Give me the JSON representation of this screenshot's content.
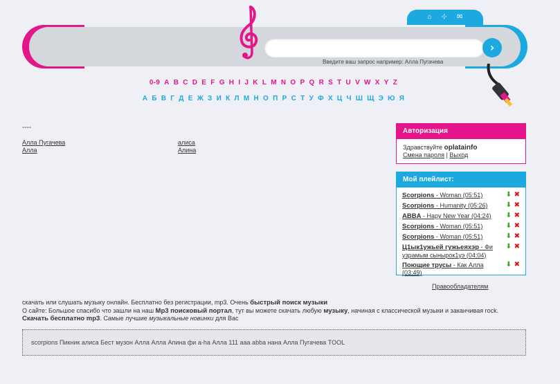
{
  "header": {
    "icons": [
      "home-icon",
      "sitemap-icon",
      "mail-icon"
    ],
    "search_placeholder": "",
    "search_button": "›",
    "search_hint": "Введите ваш запрос например: Алла Пугачева"
  },
  "alphabet": {
    "latin": [
      "0-9",
      "A",
      "B",
      "C",
      "D",
      "E",
      "F",
      "G",
      "H",
      "I",
      "J",
      "K",
      "L",
      "M",
      "N",
      "O",
      "P",
      "Q",
      "R",
      "S",
      "T",
      "U",
      "V",
      "W",
      "X",
      "Y",
      "Z"
    ],
    "cyrillic": [
      "А",
      "Б",
      "В",
      "Г",
      "Д",
      "Е",
      "Ж",
      "З",
      "И",
      "К",
      "Л",
      "М",
      "Н",
      "О",
      "П",
      "Р",
      "С",
      "Т",
      "У",
      "Ф",
      "Х",
      "Ц",
      "Ч",
      "Ш",
      "Щ",
      "Э",
      "Ю",
      "Я"
    ]
  },
  "main": {
    "dash": "----",
    "col1": [
      "Алла Пугачева",
      "Алла"
    ],
    "col2": [
      "алиса",
      "Алина"
    ]
  },
  "auth": {
    "title": "Авторизация",
    "greeting": "Здравствуйте",
    "user": "oplatainfo",
    "change_password": "Смена пароля",
    "separator": "|",
    "logout": "Выход"
  },
  "playlist": {
    "title": "Мой плейлист:",
    "items": [
      {
        "artist": "Scorpions",
        "track": " - Woman (05:51)"
      },
      {
        "artist": "Scorpions",
        "track": " - Humanity (05:26)"
      },
      {
        "artist": "ABBA",
        "track": " - Hapy New Year (04:24)"
      },
      {
        "artist": "Scorpions",
        "track": " - Woman (05:51)"
      },
      {
        "artist": "Scorpions",
        "track": " - Woman (05:51)"
      },
      {
        "artist": "Ц1ык1ужьей гужьеяхэр",
        "track": " - Фи узрамым сынырок1уэ (04:04)"
      },
      {
        "artist": "Поющие трусы",
        "track": " - Как Алла (03:49)"
      }
    ]
  },
  "rights_link": "Правообладателям",
  "about": {
    "p1_a": "скачать или слушать музыку онлайн. Бесплатно без регистрации, mp3. Очень ",
    "p1_b": "быстрый поиск музыки",
    "p2_a": "О сайте: Большое спасибо что зашли на наш ",
    "p2_b": "Mp3 поисковый портал",
    "p2_c": ", тут вы можете скачать любую ",
    "p2_d": "музыку",
    "p2_e": ", начиная с классической музыки и заканчивая rock.",
    "p3_a": "Скачать бесплатно mp3",
    "p3_b": ". Самые лучшие ",
    "p3_c": "музыкальные новинки",
    "p3_d": " для Вас"
  },
  "tags": "scorpions Пикник алиса Бест музон Алла Алла Апина фи a-ha Алла 111 aaa abba нана Алла Пугачева TOOL",
  "colors": {
    "pink": "#e5158b",
    "blue": "#1ca9e0"
  }
}
